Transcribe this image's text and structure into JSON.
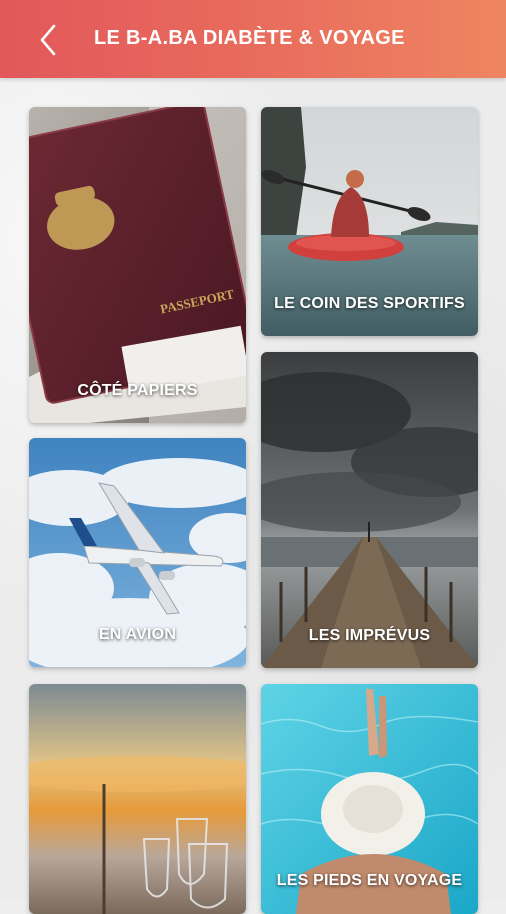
{
  "header": {
    "title": "LE B-A.BA DIABÈTE & VOYAGE",
    "back_icon": "chevron-left-icon",
    "colors": {
      "start": "#e2585b",
      "end": "#ee8561"
    }
  },
  "cards": [
    {
      "id": "papiers",
      "label": "CÔTÉ PAPIERS"
    },
    {
      "id": "sportifs",
      "label": "LE COIN DES SPORTIFS"
    },
    {
      "id": "avion",
      "label": "EN AVION"
    },
    {
      "id": "imprevus",
      "label": "LES IMPRÉVUS"
    },
    {
      "id": "sunset",
      "label": ""
    },
    {
      "id": "pieds",
      "label": "LES PIEDS EN VOYAGE"
    }
  ],
  "passport_text": "PASSEPORT"
}
